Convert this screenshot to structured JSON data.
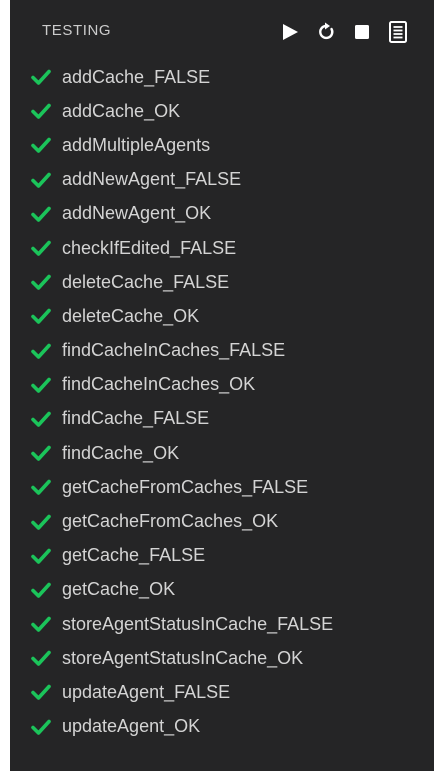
{
  "panel": {
    "title": "TESTING",
    "actions": [
      {
        "name": "run-all-icon"
      },
      {
        "name": "refresh-icon"
      },
      {
        "name": "stop-icon"
      },
      {
        "name": "output-log-icon"
      }
    ]
  },
  "colors": {
    "background": "#252526",
    "pass": "#1bc45a",
    "text": "#d4d4d4"
  },
  "tests": [
    {
      "name": "addCache_FALSE",
      "status": "passed",
      "icon": "check-icon"
    },
    {
      "name": "addCache_OK",
      "status": "passed",
      "icon": "check-icon"
    },
    {
      "name": "addMultipleAgents",
      "status": "passed",
      "icon": "check-icon"
    },
    {
      "name": "addNewAgent_FALSE",
      "status": "passed",
      "icon": "check-icon"
    },
    {
      "name": "addNewAgent_OK",
      "status": "passed",
      "icon": "check-icon"
    },
    {
      "name": "checkIfEdited_FALSE",
      "status": "passed",
      "icon": "check-icon"
    },
    {
      "name": "deleteCache_FALSE",
      "status": "passed",
      "icon": "check-icon"
    },
    {
      "name": "deleteCache_OK",
      "status": "passed",
      "icon": "check-icon"
    },
    {
      "name": "findCacheInCaches_FALSE",
      "status": "passed",
      "icon": "check-icon"
    },
    {
      "name": "findCacheInCaches_OK",
      "status": "passed",
      "icon": "check-icon"
    },
    {
      "name": "findCache_FALSE",
      "status": "passed",
      "icon": "check-icon"
    },
    {
      "name": "findCache_OK",
      "status": "passed",
      "icon": "check-icon"
    },
    {
      "name": "getCacheFromCaches_FALSE",
      "status": "passed",
      "icon": "check-icon"
    },
    {
      "name": "getCacheFromCaches_OK",
      "status": "passed",
      "icon": "check-icon"
    },
    {
      "name": "getCache_FALSE",
      "status": "passed",
      "icon": "check-icon"
    },
    {
      "name": "getCache_OK",
      "status": "passed",
      "icon": "check-icon"
    },
    {
      "name": "storeAgentStatusInCache_FALSE",
      "status": "passed",
      "icon": "check-icon"
    },
    {
      "name": "storeAgentStatusInCache_OK",
      "status": "passed",
      "icon": "check-icon"
    },
    {
      "name": "updateAgent_FALSE",
      "status": "passed",
      "icon": "check-icon"
    },
    {
      "name": "updateAgent_OK",
      "status": "passed",
      "icon": "check-icon"
    }
  ]
}
